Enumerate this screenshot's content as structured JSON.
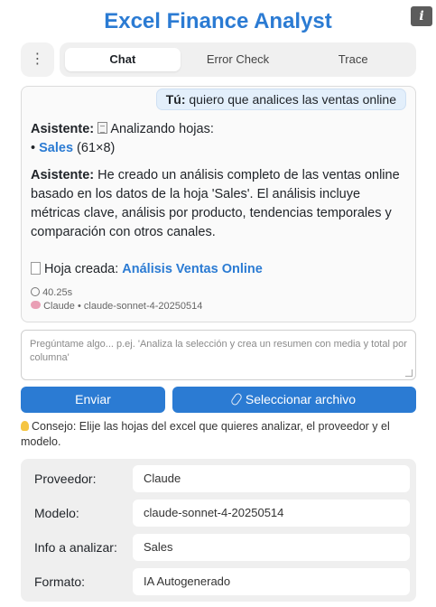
{
  "app": {
    "title": "Excel Finance Analyst",
    "info_glyph": "i"
  },
  "tabs": [
    {
      "label": "Chat",
      "active": true
    },
    {
      "label": "Error Check",
      "active": false
    },
    {
      "label": "Trace",
      "active": false
    }
  ],
  "menu": {
    "glyph": "⋮"
  },
  "chat": {
    "user": {
      "speaker": "Tú:",
      "text": "quiero que analices las ventas online"
    },
    "assistant_1": {
      "speaker": "Asistente:",
      "text": "Analizando hojas:",
      "sheet_bullet": "•",
      "sheet_name": "Sales",
      "sheet_dims": "(61×8)"
    },
    "assistant_2": {
      "speaker": "Asistente:",
      "text": "He creado un análisis completo de las ventas online basado en los datos de la hoja 'Sales'. El análisis incluye métricas clave, análisis por producto, tendencias temporales y comparación con otros canales.",
      "created_label": "Hoja creada:",
      "created_sheet": "Análisis Ventas Online"
    },
    "meta": {
      "elapsed": "40.25s",
      "model_info": "Claude • claude-sonnet-4-20250514"
    }
  },
  "input": {
    "placeholder": "Pregúntame algo... p.ej. 'Analiza la selección y crea un resumen con media y total por columna'"
  },
  "buttons": {
    "send": "Enviar",
    "select_file": "Seleccionar archivo"
  },
  "tip": {
    "text": "Consejo: Elije las hojas del excel que quieres analizar, el proveedor y el modelo."
  },
  "form": {
    "provider": {
      "label": "Proveedor:",
      "value": "Claude"
    },
    "model": {
      "label": "Modelo:",
      "value": "claude-sonnet-4-20250514"
    },
    "info": {
      "label": "Info a analizar:",
      "value": "Sales"
    },
    "format": {
      "label": "Formato:",
      "value": "IA Autogenerado"
    }
  },
  "colors": {
    "accent": "#2b7bd3",
    "user_bubble": "#e3effb"
  }
}
